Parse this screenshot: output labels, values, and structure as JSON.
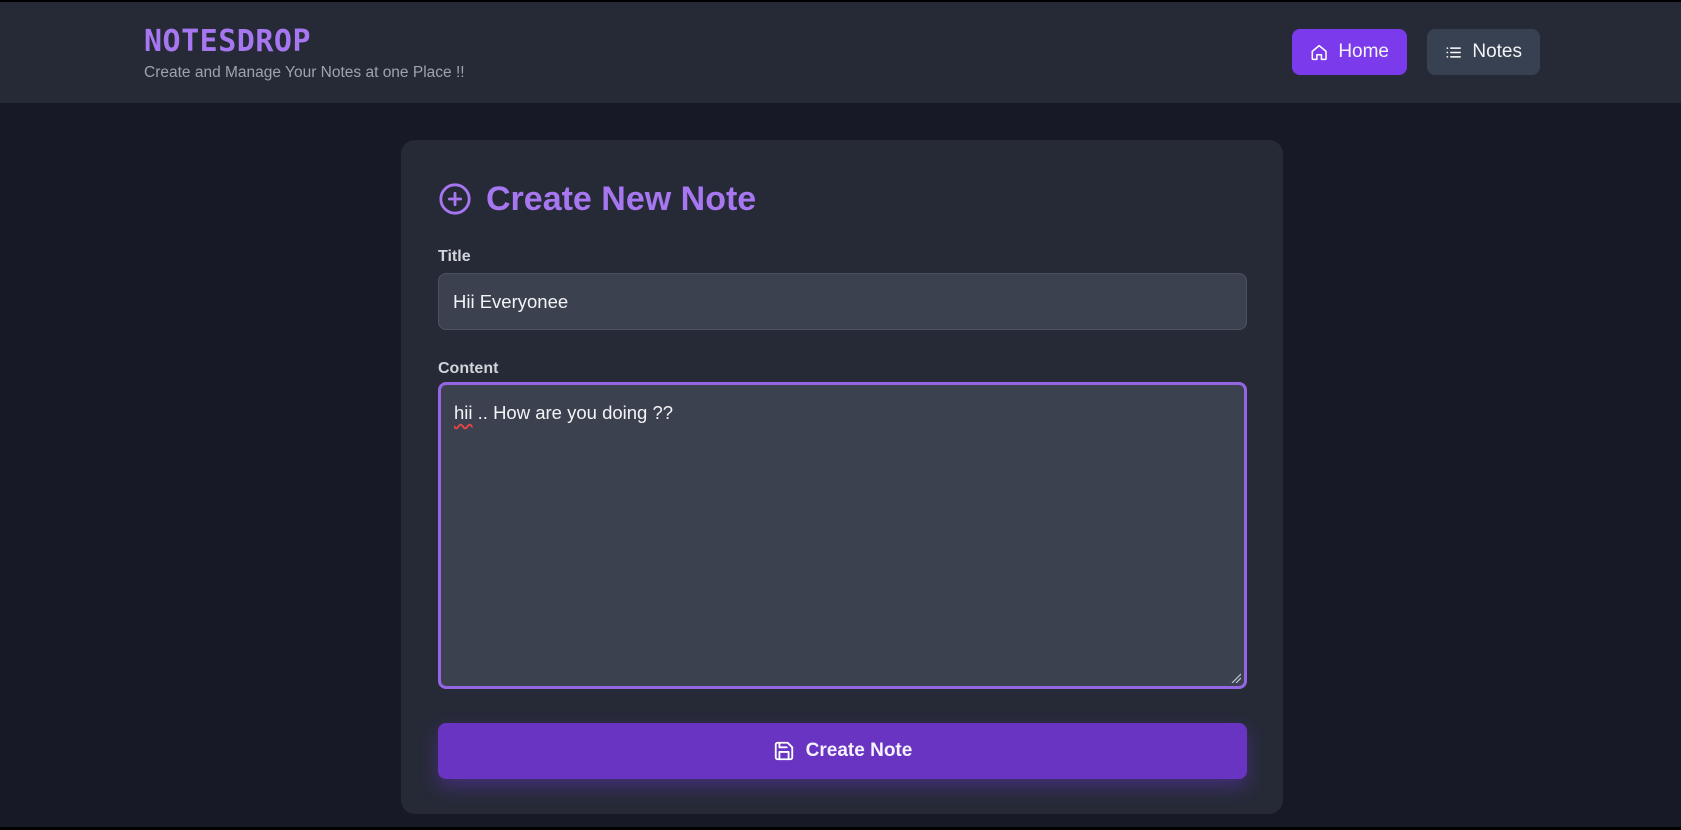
{
  "header": {
    "brand": "NOTESDROP",
    "tagline": "Create and Manage Your Notes at one Place !!",
    "nav": {
      "home_label": "Home",
      "notes_label": "Notes"
    }
  },
  "form": {
    "heading": "Create New Note",
    "title_label": "Title",
    "title_value": "Hii Everyonee",
    "content_label": "Content",
    "content_value_first_word": "hii",
    "content_value_rest": " .. How are you doing ??",
    "submit_label": "Create Note"
  },
  "colors": {
    "accent": "#a677f0",
    "primary_button": "#7c3aed",
    "submit_button": "#6a34c2",
    "background": "#171a26",
    "card": "#262a37"
  },
  "icons": {
    "home": "home-icon",
    "notes": "list-icon",
    "heading": "plus-circle-icon",
    "submit": "save-icon"
  }
}
